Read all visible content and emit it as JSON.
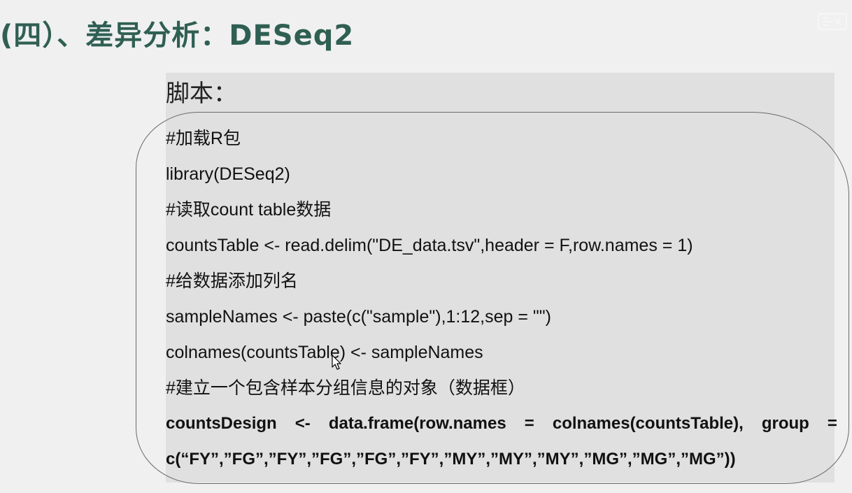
{
  "title": "(四）、差异分析：DESeq2",
  "script_label": "脚本：",
  "code": {
    "line1": "#加载R包",
    "line2": "library(DESeq2)",
    "line3": "#读取count table数据",
    "line4": "countsTable <- read.delim(\"DE_data.tsv\",header = F,row.names = 1)",
    "line5": "#给数据添加列名",
    "line6": "sampleNames <- paste(c(\"sample\"),1:12,sep = \"\")",
    "line7": "colnames(countsTable) <- sampleNames",
    "line8": "#建立一个包含样本分组信息的对象（数据框）",
    "line9_tokens": [
      "countsDesign",
      "<-",
      "data.frame(row.names",
      "=",
      "colnames(countsTable),",
      "group",
      "="
    ],
    "line10": "c(“FY”,”FG”,”FY”,”FG”,”FG”,”FY”,”MY”,”MY”,”MY”,”MG”,”MG”,”MG”))"
  },
  "colors": {
    "title": "#2f5f52",
    "background": "#f0f0f0",
    "panel": "#e0e0e0",
    "text": "#111111"
  },
  "icons": {
    "watermark": "watermark-logo-icon",
    "cursor": "mouse-cursor-icon"
  }
}
